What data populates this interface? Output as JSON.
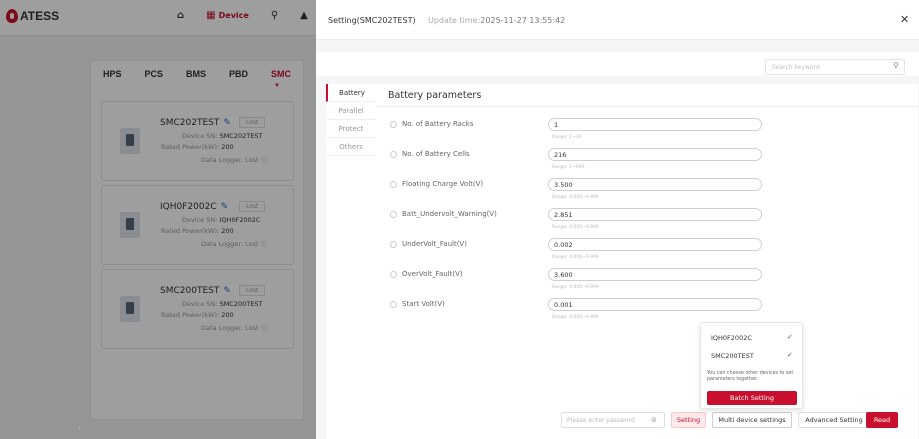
{
  "app": {
    "brand": "ATESS",
    "nav": [
      "",
      "Device",
      "",
      ""
    ],
    "tabs": [
      "HPS",
      "PCS",
      "BMS",
      "PBD",
      "SMC"
    ]
  },
  "devices": [
    {
      "name": "SMC202TEST",
      "status": "Lost",
      "sn_label": "Device SN:",
      "sn": "SMC202TEST",
      "power_label": "Rated Power(kW):",
      "power": "200",
      "logger_label": "Data Logger:",
      "logger": "Lost"
    },
    {
      "name": "IQH0F2002C",
      "status": "Lost",
      "sn_label": "Device SN:",
      "sn": "IQH0F2002C",
      "power_label": "Rated Power(kW):",
      "power": "200",
      "logger_label": "Data Logger:",
      "logger": "Lost"
    },
    {
      "name": "SMC200TEST",
      "status": "Lost",
      "sn_label": "Device SN:",
      "sn": "SMC200TEST",
      "power_label": "Rated Power(kW):",
      "power": "200",
      "logger_label": "Data Logger:",
      "logger": "Lost"
    }
  ],
  "drawer": {
    "title": "Setting(SMC202TEST)",
    "update_label": "Update time:",
    "update_time": "2025-11-27 13:55:42",
    "search_placeholder": "Search keyword",
    "side_tabs": [
      "Battery",
      "Parallel",
      "Protect",
      "Others"
    ],
    "section_title": "Battery parameters",
    "params": [
      {
        "label": "No. of Battery Racks",
        "value": "1",
        "range": "Range: 1~30"
      },
      {
        "label": "No. of Battery Cells",
        "value": "216",
        "range": "Range: 1~999"
      },
      {
        "label": "Floating Charge Volt(V)",
        "value": "3.500",
        "range": "Range: 0.000~9.999"
      },
      {
        "label": "Batt_Undervolt_Warning(V)",
        "value": "2.851",
        "range": "Range: 0.000~9.999"
      },
      {
        "label": "UnderVolt_Fault(V)",
        "value": "0.002",
        "range": "Range: 0.000~9.999"
      },
      {
        "label": "OverVolt_Fault(V)",
        "value": "3.600",
        "range": "Range: 0.000~9.999"
      },
      {
        "label": "Start Volt(V)",
        "value": "0.001",
        "range": "Range: 0.000~9.999"
      }
    ],
    "footer": {
      "password_placeholder": "Please enter password",
      "setting": "Setting",
      "multi": "Multi device settings",
      "advanced": "Advanced Setting",
      "read": "Read"
    },
    "popover": {
      "devices": [
        "IQH0F2002C",
        "SMC200TEST"
      ],
      "note": "You can choose other devices to set parameters together.",
      "batch": "Batch Setting"
    }
  },
  "colors": {
    "accent": "#c8102e",
    "link": "#3366cc"
  }
}
